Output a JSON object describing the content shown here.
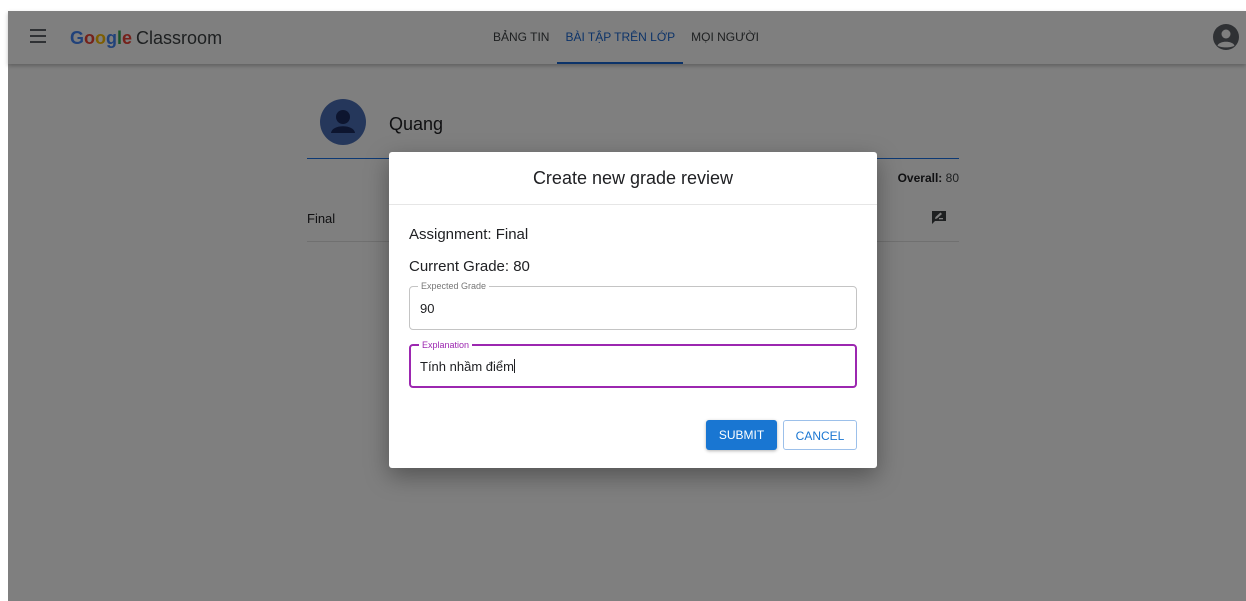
{
  "app": {
    "brand_google": "Google",
    "brand_product": "Classroom"
  },
  "nav": {
    "tabs": [
      {
        "label": "BẢNG TIN",
        "active": false
      },
      {
        "label": "BÀI TẬP TRÊN LỚP",
        "active": true
      },
      {
        "label": "MỌI NGƯỜI",
        "active": false
      }
    ]
  },
  "student": {
    "name": "Quang",
    "overall_label": "Overall:",
    "overall_value": "80",
    "assignments": [
      {
        "title": "Final"
      }
    ]
  },
  "dialog": {
    "title": "Create new grade review",
    "assignment_text": "Assignment: Final",
    "current_grade_text": "Current Grade: 80",
    "expected_grade": {
      "label": "Expected Grade",
      "value": "90"
    },
    "explanation": {
      "label": "Explanation",
      "value": "Tính nhầm điểm"
    },
    "submit_label": "SUBMIT",
    "cancel_label": "CANCEL"
  },
  "colors": {
    "primary": "#1976d2",
    "focus": "#9c27b0",
    "google_blue": "#4285F4",
    "google_red": "#EA4335",
    "google_yellow": "#FBBC05",
    "google_green": "#34A853"
  },
  "icons": {
    "menu": "menu-icon",
    "account": "account-circle-icon",
    "profile_avatar": "person-icon",
    "review": "rate-review-icon"
  }
}
